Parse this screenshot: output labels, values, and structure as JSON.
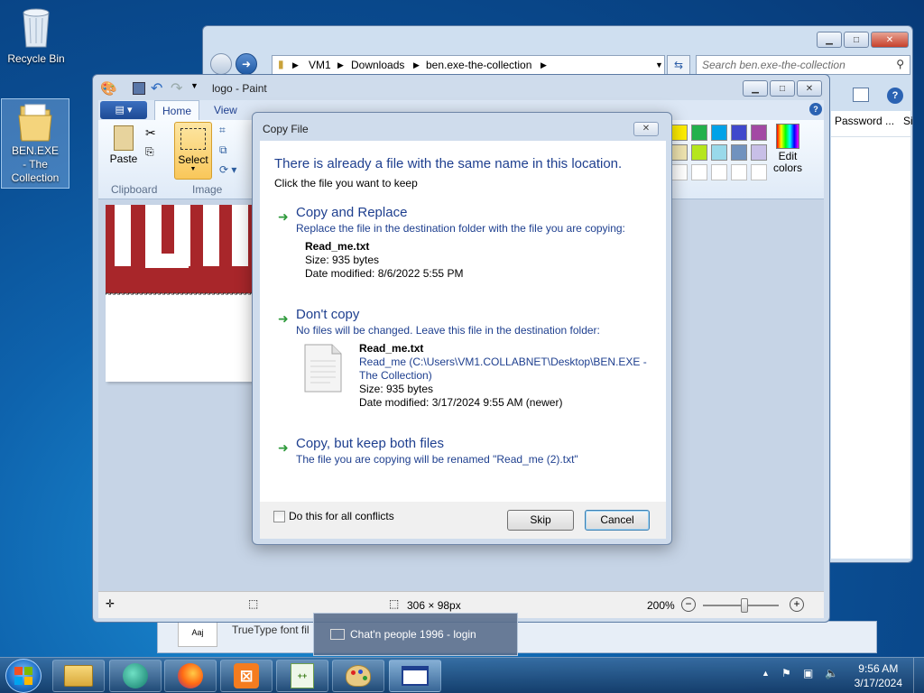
{
  "desktop": {
    "icons": [
      {
        "label": "Recycle Bin"
      },
      {
        "label": "BEN.EXE - The Collection"
      }
    ]
  },
  "explorer": {
    "breadcrumb": [
      "VM1",
      "Downloads",
      "ben.exe-the-collection"
    ],
    "search_placeholder": "Search ben.exe-the-collection",
    "columns": [
      "Password ...",
      "Si"
    ],
    "bottom_item": "TrueType font fil"
  },
  "paint": {
    "title": "logo - Paint",
    "tabs": [
      "Home",
      "View"
    ],
    "groups": {
      "clipboard": "Clipboard",
      "image": "Image"
    },
    "paste_label": "Paste",
    "select_label": "Select",
    "edit_colors_label": "Edit colors",
    "status": {
      "dimensions": "306 × 98px",
      "zoom": "200%"
    },
    "palette_colors": [
      "#ffee00",
      "#22b14c",
      "#00a2e8",
      "#3f48cc",
      "#a349a4",
      "#efe4b0",
      "#b5e61d",
      "#99d9ea",
      "#7092be",
      "#c8bfe7"
    ],
    "zoom_level": 0.55
  },
  "dialog": {
    "title": "Copy File",
    "heading": "There is already a file with the same name in this location.",
    "subheading": "Click the file you want to keep",
    "options": [
      {
        "title": "Copy and Replace",
        "desc": "Replace the file in the destination folder with the file you are copying:",
        "file_name": "Read_me.txt",
        "size": "Size: 935 bytes",
        "modified": "Date modified: 8/6/2022 5:55 PM"
      },
      {
        "title": "Don't copy",
        "desc": "No files will be changed. Leave this file in the destination folder:",
        "file_name": "Read_me.txt",
        "path_line1": "Read_me (C:\\Users\\VM1.COLLABNET\\Desktop\\BEN.EXE -",
        "path_line2": "The Collection)",
        "size": "Size: 935 bytes",
        "modified": "Date modified: 3/17/2024 9:55 AM (newer)"
      },
      {
        "title": "Copy, but keep both files",
        "desc": "The file you are copying will be renamed \"Read_me (2).txt\""
      }
    ],
    "checkbox_label": "Do this for all conflicts",
    "skip_label": "Skip",
    "cancel_label": "Cancel"
  },
  "taskbar": {
    "tooltip": "Chat'n people 1996 - login",
    "clock_time": "9:56 AM",
    "clock_date": "3/17/2024"
  }
}
